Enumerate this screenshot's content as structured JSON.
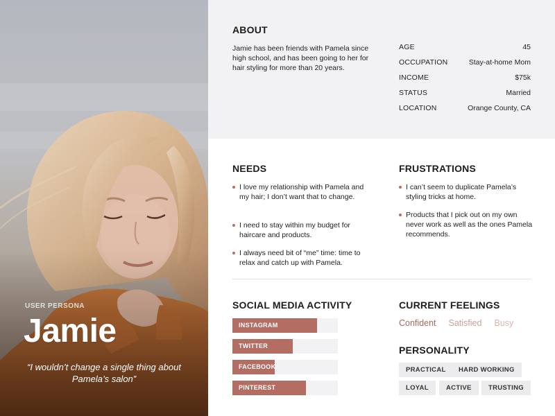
{
  "persona": {
    "caption": "USER PERSONA",
    "name": "Jamie",
    "quote": "“I wouldn’t change a single thing about Pamela’s salon”"
  },
  "about": {
    "title": "ABOUT",
    "text": "Jamie has been friends with Pamela since high school, and has been going to her for hair styling for more than 20 years.",
    "stats": [
      {
        "label": "AGE",
        "value": "45"
      },
      {
        "label": "OCCUPATION",
        "value": "Stay-at-home Mom"
      },
      {
        "label": "INCOME",
        "value": "$75k"
      },
      {
        "label": "STATUS",
        "value": "Married"
      },
      {
        "label": "LOCATION",
        "value": "Orange County, CA"
      }
    ]
  },
  "needs": {
    "title": "NEEDS",
    "items": [
      "I love my relationship with Pamela and my hair; I don’t want that to change.",
      "I need to stay within my budget for haircare and products.",
      "I always need bit of “me” time: time to relax and catch up with Pamela."
    ]
  },
  "frustrations": {
    "title": "FRUSTRATIONS",
    "items": [
      "I can’t seem to duplicate Pamela’s styling tricks at home.",
      "Products that I pick out on my own never work as well as the ones Pamela recommends."
    ]
  },
  "social": {
    "title": "SOCIAL MEDIA ACTIVITY",
    "channels": [
      {
        "label": "INSTAGRAM",
        "level": 0.8
      },
      {
        "label": "TWITTER",
        "level": 0.57
      },
      {
        "label": "FACEBOOK",
        "level": 0.4
      },
      {
        "label": "PINTEREST",
        "level": 0.7
      }
    ]
  },
  "feelings": {
    "title": "CURRENT FEELINGS",
    "items": [
      {
        "label": "Confident",
        "color": "#a8675d"
      },
      {
        "label": "Satisfied",
        "color": "#cf9f97"
      },
      {
        "label": "Busy",
        "color": "#d9b5ae"
      }
    ]
  },
  "personality": {
    "title": "PERSONALITY",
    "tags": [
      "PRACTICAL",
      "HARD WORKING",
      "LOYAL",
      "ACTIVE",
      "TRUSTING"
    ]
  },
  "colors": {
    "accent": "#b36d63",
    "panel": "#f2f2f4"
  }
}
